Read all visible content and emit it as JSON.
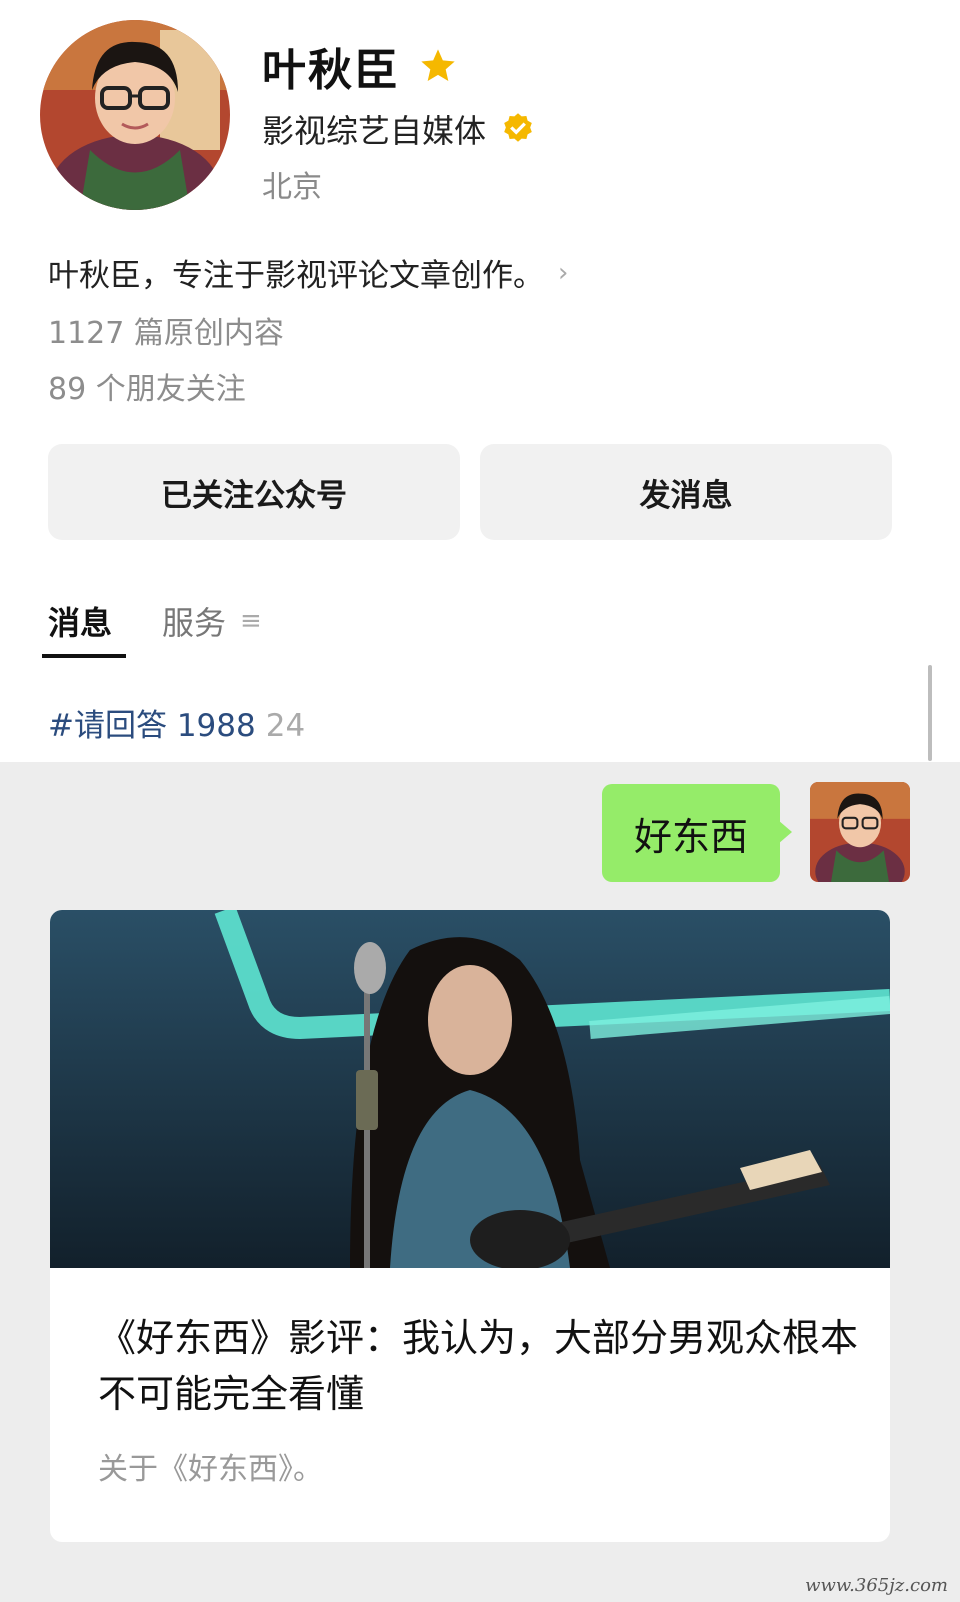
{
  "profile": {
    "name": "叶秋臣",
    "category": "影视综艺自媒体",
    "location": "北京",
    "intro": "叶秋臣，专注于影视评论文章创作。",
    "stats": {
      "articles": "1127 篇原创内容",
      "friends": "89 个朋友关注"
    },
    "icons": {
      "star": "star-icon",
      "verified": "verified-badge-icon"
    }
  },
  "actions": {
    "follow_label": "已关注公众号",
    "message_label": "发消息"
  },
  "tabs": [
    {
      "label": "消息"
    },
    {
      "label": "服务"
    }
  ],
  "hashtag": {
    "tag": "#请回答 1988",
    "count": "24"
  },
  "chat": {
    "bubble_text": "好东西",
    "article": {
      "title": "《好东西》影评：我认为，大部分男观众根本不可能完全看懂",
      "description": "关于《好东西》。"
    }
  },
  "watermark": "www.365jz.com",
  "colors": {
    "bubble": "#95ec69",
    "hashtag": "#2b4c7e",
    "star": "#f5b800",
    "chat_bg": "#ededed"
  }
}
